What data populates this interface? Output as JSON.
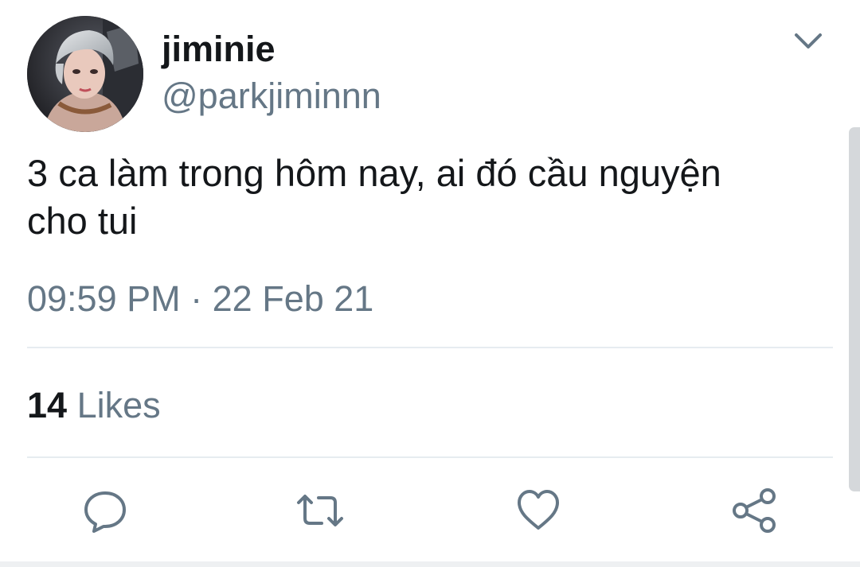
{
  "tweet": {
    "display_name": "jiminie",
    "handle": "@parkjiminnn",
    "text_line1": "3 ca làm trong hôm nay, ai đó cầu nguyện",
    "text_line2": "cho tui",
    "time": "09:59 PM",
    "separator": "·",
    "date": "22 Feb 21",
    "likes_count": "14",
    "likes_label": "Likes"
  },
  "icons": {
    "menu": "chevron-down-icon",
    "reply": "reply-icon",
    "retweet": "retweet-icon",
    "like": "heart-icon",
    "share": "share-icon"
  },
  "colors": {
    "text_primary": "#14171a",
    "text_secondary": "#657786",
    "icon": "#657786",
    "divider": "#e6ecf0"
  }
}
